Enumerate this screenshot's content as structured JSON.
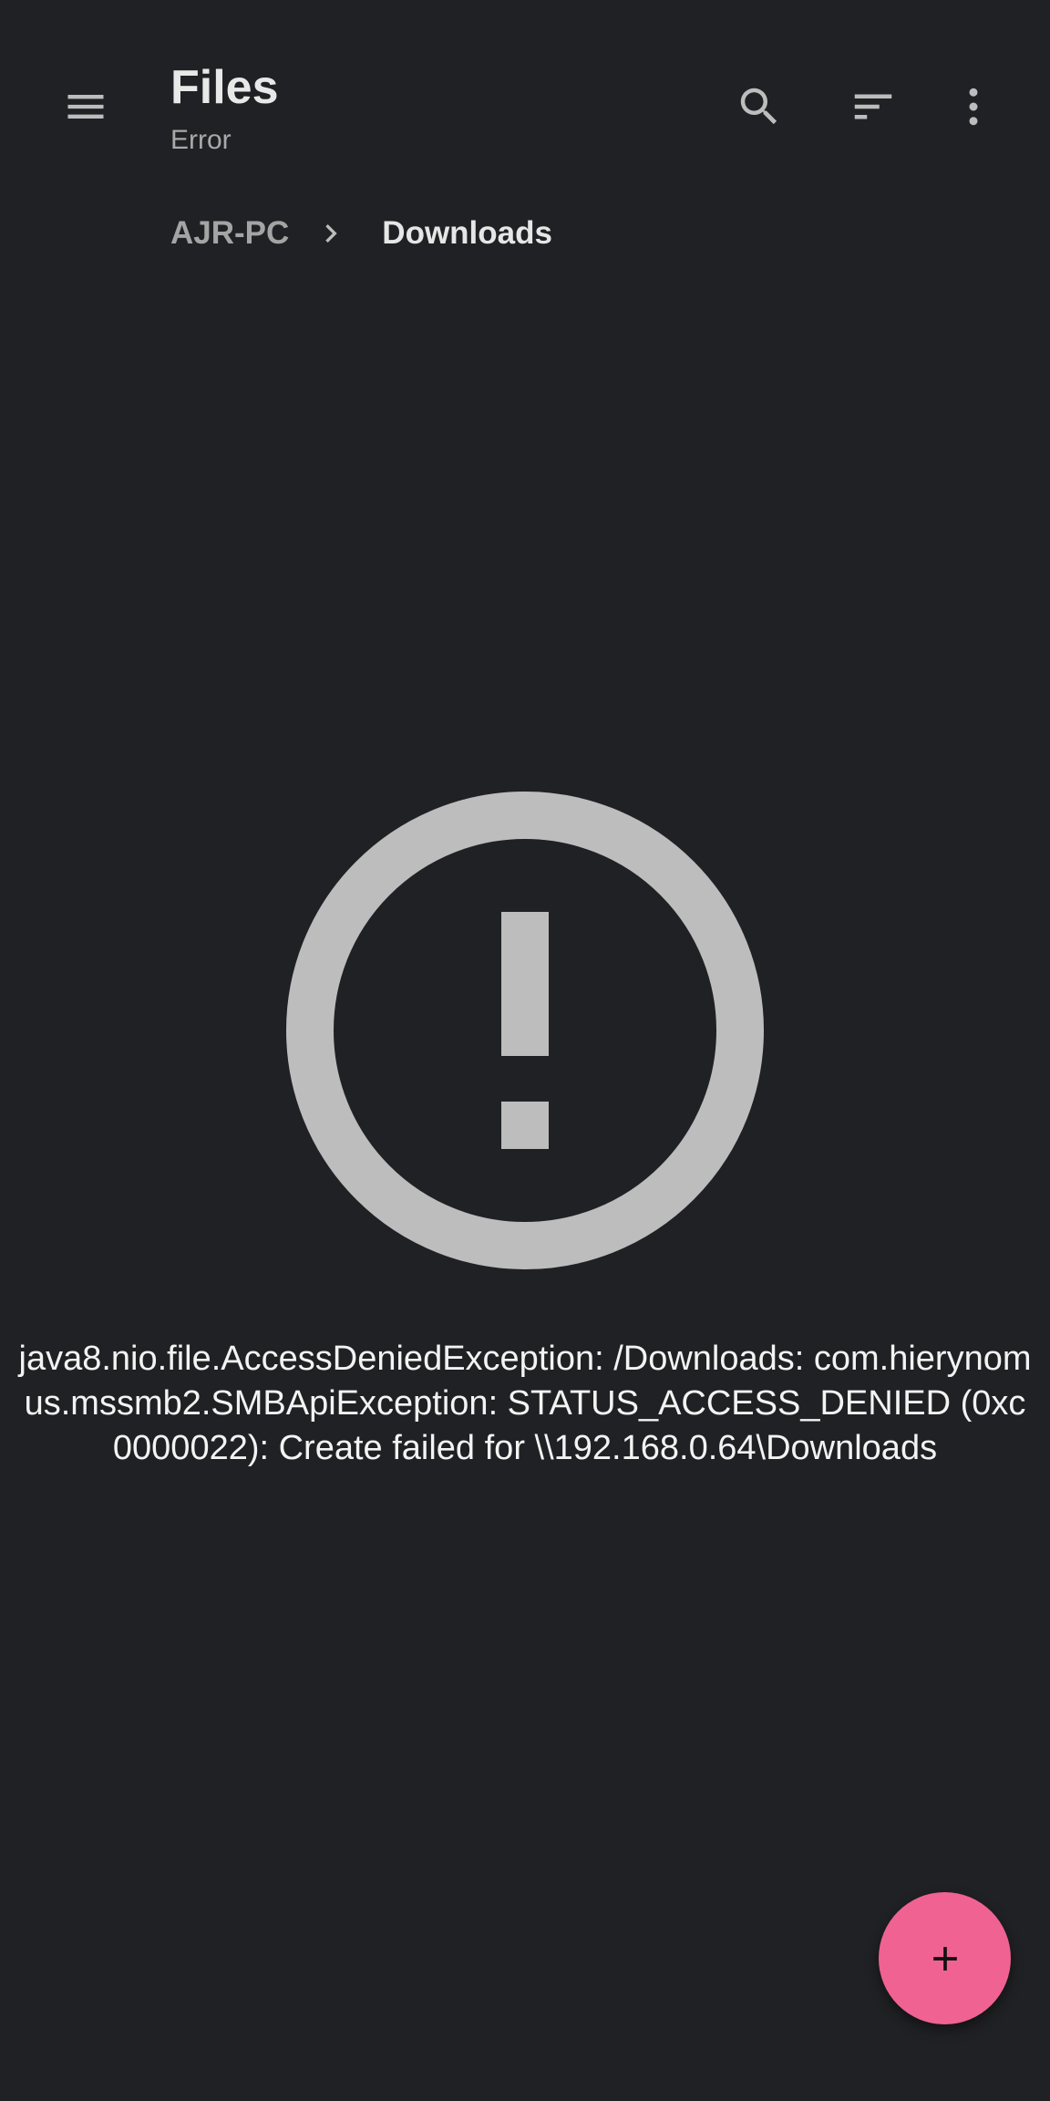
{
  "app_bar": {
    "title": "Files",
    "subtitle": "Error",
    "icons": {
      "navigation": "menu-icon",
      "search": "search-icon",
      "sort": "sort-icon",
      "overflow": "more-vert-icon"
    }
  },
  "breadcrumb": {
    "items": [
      {
        "label": "AJR-PC"
      },
      {
        "label": "Downloads"
      }
    ],
    "separator_icon": "chevron-right-icon"
  },
  "error": {
    "icon": "error-outline-icon",
    "message": "java8.nio.file.AccessDeniedException: /Downloads: com.hierynomus.mssmb2.SMBApiException: STATUS_ACCESS_DENIED (0xc0000022): Create failed for \\\\192.168.0.64\\Downloads"
  },
  "fab": {
    "icon": "plus-icon"
  },
  "colors": {
    "background": "#202124",
    "icon": "#bdbdbd",
    "title_text": "#e8e8e8",
    "subtitle_text": "#a9a9a9",
    "fab": "#f06292",
    "fab_icon": "#111111"
  }
}
